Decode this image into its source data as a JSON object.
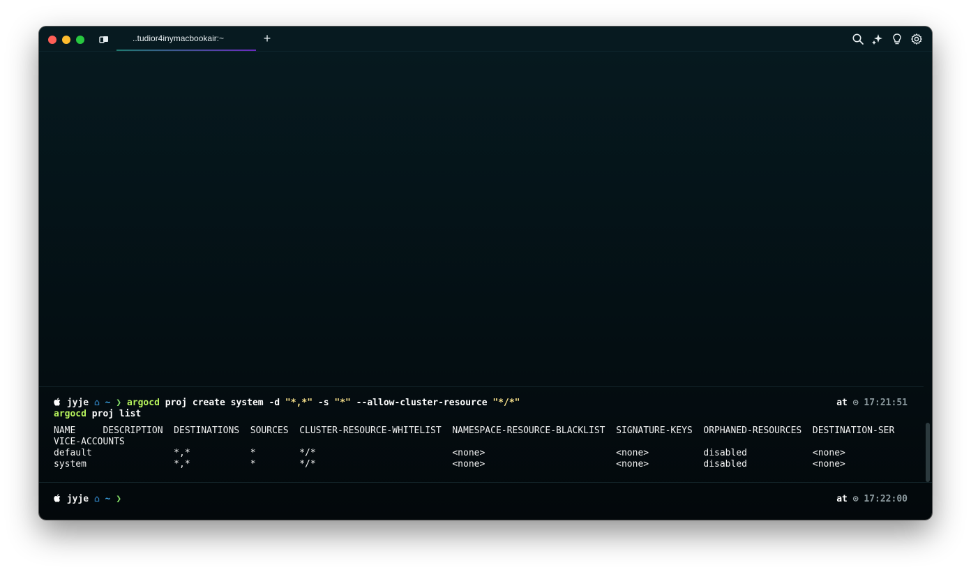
{
  "window": {
    "tab_title": "..tudior4inymacbookair:~",
    "new_tab_label": "+"
  },
  "toolbar_icons": [
    "search-icon",
    "ai-sparkle-icon",
    "lightbulb-icon",
    "settings-gear-icon"
  ],
  "block1": {
    "user": "jyje",
    "home_glyph": "⌂",
    "dir": "~",
    "chevron": "❯",
    "command_line1": {
      "cmd": "argocd",
      "args1": " proj create system -d ",
      "s1": "\"*,*\"",
      "args2": " -s ",
      "s2": "\"*\"",
      "args3": " --allow-cluster-resource ",
      "s3": "\"*/*\""
    },
    "command_line2": {
      "cmd": "argocd",
      "args": " proj list"
    },
    "at": "at",
    "clock": "⊙",
    "time": "17:21:51",
    "output": {
      "header_line1": "NAME     DESCRIPTION  DESTINATIONS  SOURCES  CLUSTER-RESOURCE-WHITELIST  NAMESPACE-RESOURCE-BLACKLIST  SIGNATURE-KEYS  ORPHANED-RESOURCES  DESTINATION-SER",
      "header_line2": "VICE-ACCOUNTS",
      "rows": [
        "default               *,*           *        */*                         <none>                        <none>          disabled            <none>",
        "system                *,*           *        */*                         <none>                        <none>          disabled            <none>"
      ]
    }
  },
  "block2": {
    "user": "jyje",
    "home_glyph": "⌂",
    "dir": "~",
    "chevron": "❯",
    "at": "at",
    "clock": "⊙",
    "time": "17:22:00"
  }
}
